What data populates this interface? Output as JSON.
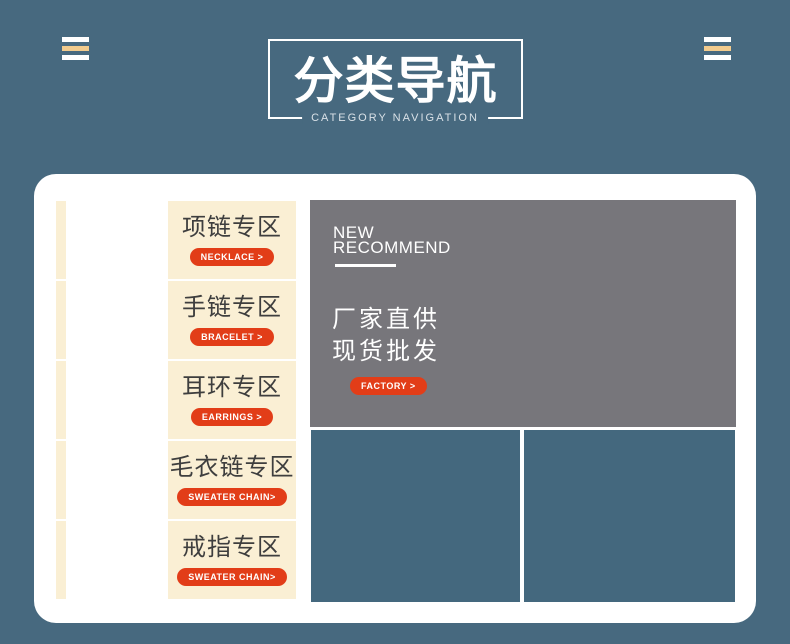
{
  "header": {
    "title": "分类导航",
    "subtitle": "CATEGORY NAVIGATION"
  },
  "categories": [
    {
      "title": "项链专区",
      "button": "NECKLACE >"
    },
    {
      "title": "手链专区",
      "button": "BRACELET >"
    },
    {
      "title": "耳环专区",
      "button": "EARRINGS >"
    },
    {
      "title": "毛衣链专区",
      "button": "SWEATER CHAIN>"
    },
    {
      "title": "戒指专区",
      "button": "SWEATER CHAIN>"
    }
  ],
  "promo": {
    "heading_line1": "NEW",
    "heading_line2": "RECOMMEND",
    "slogan_line1": "厂家直供",
    "slogan_line2": "现货批发",
    "button": "FACTORY >"
  },
  "colors": {
    "page_background": "#47697f",
    "card_background": "#ffffff",
    "category_background": "#faefd4",
    "accent_red": "#e23d18",
    "promo_gray": "#77767b",
    "placeholder_blue": "#44687e",
    "hamburger_tan": "#f2cb8d",
    "category_text": "#3e3e3e"
  }
}
